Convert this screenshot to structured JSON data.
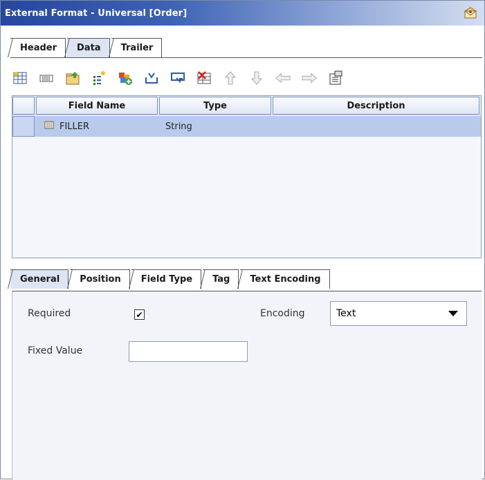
{
  "window": {
    "title": "External Format - Universal [Order]",
    "title_icon": "envelope-icon"
  },
  "top_tabs": [
    {
      "label": "Header",
      "active": false
    },
    {
      "label": "Data",
      "active": true
    },
    {
      "label": "Trailer",
      "active": false
    }
  ],
  "toolbar": {
    "icons": [
      "table-insert-icon",
      "field-icon",
      "folder-up-icon",
      "add-field-icon",
      "add-group-icon",
      "import-icon",
      "export-icon",
      "delete-table-icon",
      "move-up-icon",
      "move-down-icon",
      "move-left-icon",
      "move-right-icon",
      "properties-icon"
    ]
  },
  "grid": {
    "columns": [
      "Field Name",
      "Type",
      "Description"
    ],
    "rows": [
      {
        "icon": "field-icon",
        "field_name": "FILLER",
        "type": "String",
        "description": ""
      }
    ]
  },
  "bottom_tabs": [
    {
      "label": "General",
      "active": true
    },
    {
      "label": "Position",
      "active": false
    },
    {
      "label": "Field Type",
      "active": false
    },
    {
      "label": "Tag",
      "active": false
    },
    {
      "label": "Text Encoding",
      "active": false
    }
  ],
  "general": {
    "required_label": "Required",
    "required_checked": "✔",
    "encoding_label": "Encoding",
    "encoding_value": "Text",
    "fixed_value_label": "Fixed Value",
    "fixed_value": ""
  },
  "colors": {
    "title_bar_start": "#26479c",
    "selected_row": "#b9cbec",
    "panel_bg": "#f3f4fa"
  }
}
